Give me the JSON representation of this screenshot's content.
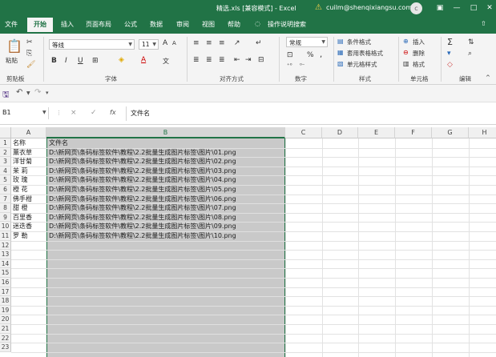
{
  "title_bar": {
    "document": "精选.xls [兼容模式] - Excel",
    "user_email": "cuilm@shenqixiangsu.com",
    "avatar_letter": "c"
  },
  "tabs": [
    "文件",
    "开始",
    "插入",
    "页面布局",
    "公式",
    "数据",
    "审阅",
    "视图",
    "帮助",
    "操作说明搜索"
  ],
  "ribbon": {
    "clipboard": {
      "paste": "粘贴",
      "label": "剪贴板"
    },
    "font": {
      "name": "等线",
      "size": "11",
      "label": "字体",
      "bold": "B",
      "italic": "I",
      "underline": "U",
      "font_color": "A",
      "grow": "A",
      "shrink": "A"
    },
    "alignment": {
      "label": "对齐方式"
    },
    "number": {
      "format": "常规",
      "label": "数字",
      "percent": "%",
      "comma": ","
    },
    "styles": {
      "conditional": "条件格式",
      "table": "套用表格格式",
      "cell_styles": "单元格样式",
      "label": "样式"
    },
    "cells": {
      "insert": "插入",
      "delete": "删除",
      "format": "格式",
      "label": "单元格"
    },
    "editing": {
      "sum": "Σ",
      "label": "编辑"
    }
  },
  "formula_bar": {
    "name_box": "B1",
    "cancel": "×",
    "enter": "✓",
    "fx": "fx",
    "value": "文件名"
  },
  "columns": [
    "A",
    "B",
    "C",
    "D",
    "E",
    "F",
    "G",
    "H"
  ],
  "rows": [
    "1",
    "2",
    "3",
    "4",
    "5",
    "6",
    "7",
    "8",
    "9",
    "10",
    "11",
    "12",
    "13",
    "14",
    "15",
    "16",
    "17",
    "18",
    "19",
    "20",
    "21",
    "22",
    "23"
  ],
  "cells": {
    "a1": "名称",
    "b1": "文件名",
    "data": [
      {
        "name": "薰衣草",
        "file": "D:\\新网页\\条码标签软件\\教程\\2.2批量生成图片标签\\图片\\01.png"
      },
      {
        "name": "洋甘菊",
        "file": "D:\\新网页\\条码标签软件\\教程\\2.2批量生成图片标签\\图片\\02.png"
      },
      {
        "name": "茉  莉",
        "file": "D:\\新网页\\条码标签软件\\教程\\2.2批量生成图片标签\\图片\\03.png"
      },
      {
        "name": "玫  瑰",
        "file": "D:\\新网页\\条码标签软件\\教程\\2.2批量生成图片标签\\图片\\04.png"
      },
      {
        "name": "橙  花",
        "file": "D:\\新网页\\条码标签软件\\教程\\2.2批量生成图片标签\\图片\\05.png"
      },
      {
        "name": "佛手柑",
        "file": "D:\\新网页\\条码标签软件\\教程\\2.2批量生成图片标签\\图片\\06.png"
      },
      {
        "name": "甜  橙",
        "file": "D:\\新网页\\条码标签软件\\教程\\2.2批量生成图片标签\\图片\\07.png"
      },
      {
        "name": "百里香",
        "file": "D:\\新网页\\条码标签软件\\教程\\2.2批量生成图片标签\\图片\\08.png"
      },
      {
        "name": "迷迭香",
        "file": "D:\\新网页\\条码标签软件\\教程\\2.2批量生成图片标签\\图片\\09.png"
      },
      {
        "name": "罗  勒",
        "file": "D:\\新网页\\条码标签软件\\教程\\2.2批量生成图片标签\\图片\\10.png"
      }
    ]
  },
  "colors": {
    "accent": "#217346",
    "selection": "#c9c9c9"
  }
}
